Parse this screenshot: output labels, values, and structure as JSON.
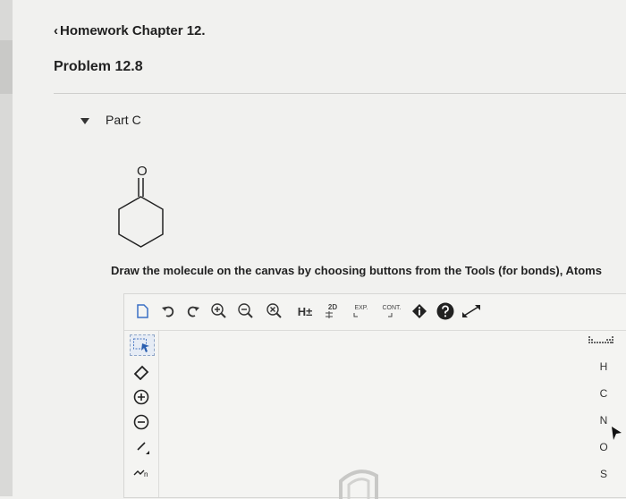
{
  "nav": {
    "back_label": "Homework Chapter 12."
  },
  "problem": {
    "title": "Problem 12.8"
  },
  "part": {
    "label": "Part C"
  },
  "molecule": {
    "atom_label": "O"
  },
  "instructions": {
    "text": "Draw the molecule on the canvas by choosing buttons from the Tools (for bonds), Atoms"
  },
  "toolbar": {
    "h_label": "H±",
    "label_2d": "2D",
    "exp_label": "EXP.",
    "cont_label": "CONT."
  },
  "atoms": [
    "H",
    "C",
    "N",
    "O",
    "S"
  ],
  "left_tools": {
    "chain_label": "n"
  },
  "colors": {
    "background": "#f1f1ef",
    "icon": "#333333",
    "selected": "#8fa6c8"
  }
}
